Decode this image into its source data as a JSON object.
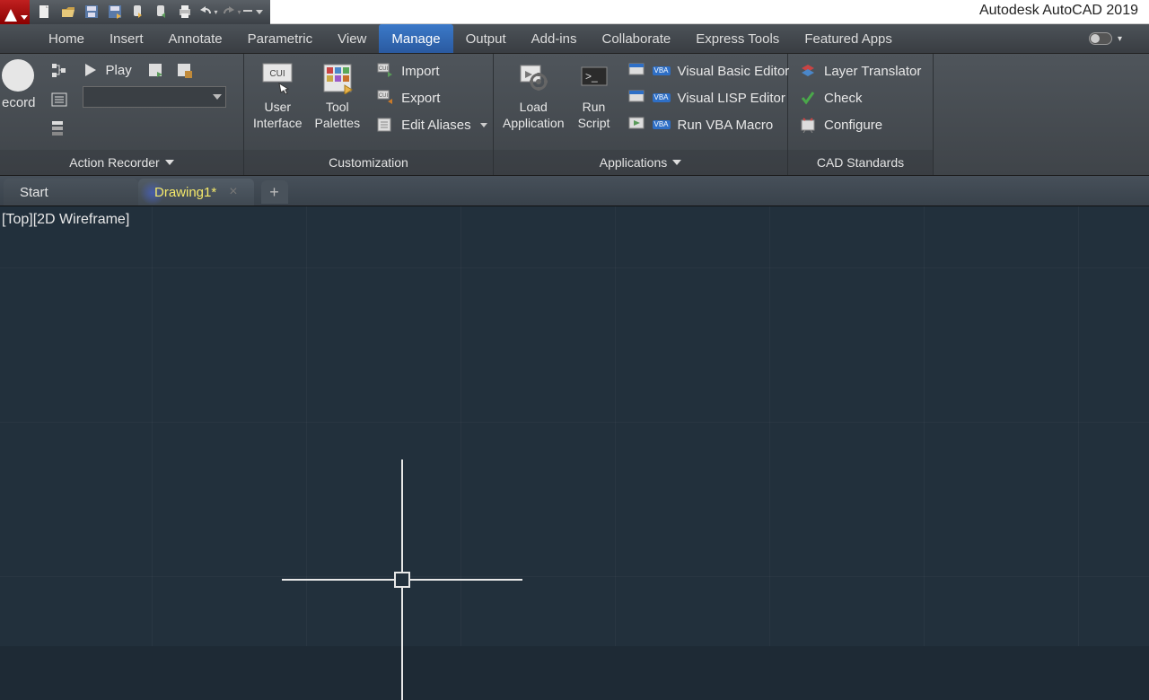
{
  "title": "Autodesk AutoCAD 2019",
  "menu": {
    "items": [
      "Home",
      "Insert",
      "Annotate",
      "Parametric",
      "View",
      "Manage",
      "Output",
      "Add-ins",
      "Collaborate",
      "Express Tools",
      "Featured Apps"
    ],
    "active": "Manage"
  },
  "ribbon": {
    "action_recorder": {
      "label": "Action Recorder",
      "record": "ecord",
      "play": "Play"
    },
    "customization": {
      "label": "Customization",
      "user_interface": "User\nInterface",
      "tool_palettes": "Tool\nPalettes",
      "import": "Import",
      "export": "Export",
      "edit_aliases": "Edit Aliases",
      "cui": "CUI"
    },
    "applications": {
      "label": "Applications",
      "load_application": "Load\nApplication",
      "run_script": "Run\nScript",
      "vbe": "Visual Basic Editor",
      "vlisp": "Visual LISP Editor",
      "run_vba": "Run VBA Macro"
    },
    "cad_standards": {
      "label": "CAD Standards",
      "layer_translator": "Layer Translator",
      "check": "Check",
      "configure": "Configure"
    }
  },
  "doctabs": {
    "start": "Start",
    "drawing": "Drawing1*"
  },
  "viewport": {
    "label": "[Top][2D Wireframe]"
  }
}
